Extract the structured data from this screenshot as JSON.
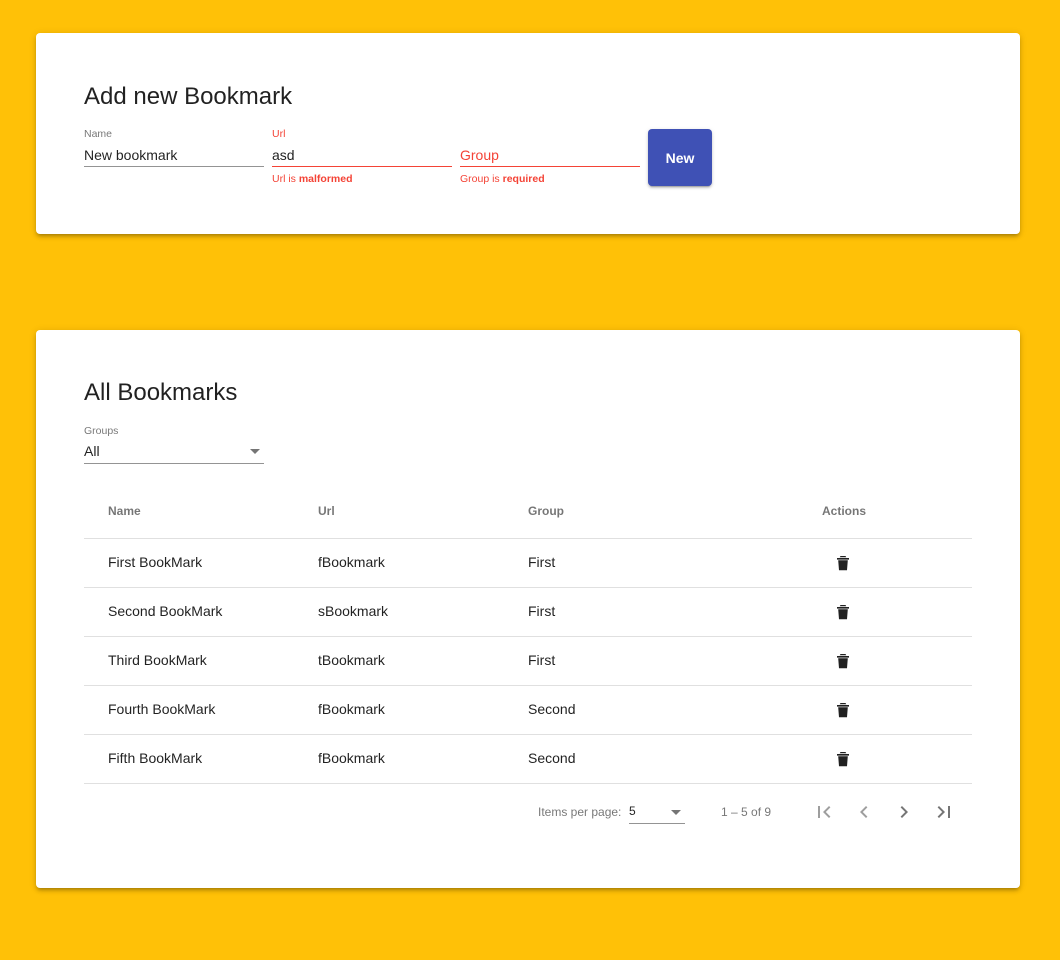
{
  "add_card": {
    "title": "Add new Bookmark",
    "name_field": {
      "label": "Name",
      "value": "New bookmark"
    },
    "url_field": {
      "label": "Url",
      "value": "asd",
      "error_prefix": "Url is ",
      "error_strong": "malformed"
    },
    "group_field": {
      "placeholder": "Group",
      "value": "",
      "error_prefix": "Group is ",
      "error_strong": "required"
    },
    "new_button": "New",
    "colors": {
      "accent": "#3f51b5",
      "error": "#f44336",
      "background": "#ffc107"
    }
  },
  "list_card": {
    "title": "All Bookmarks",
    "groups_select": {
      "label": "Groups",
      "value": "All"
    },
    "table": {
      "headers": {
        "name": "Name",
        "url": "Url",
        "group": "Group",
        "actions": "Actions"
      },
      "rows": [
        {
          "name": "First BookMark",
          "url": "fBookmark",
          "group": "First",
          "action_icon": "delete-icon"
        },
        {
          "name": "Second BookMark",
          "url": "sBookmark",
          "group": "First",
          "action_icon": "delete-icon"
        },
        {
          "name": "Third BookMark",
          "url": "tBookmark",
          "group": "First",
          "action_icon": "delete-icon"
        },
        {
          "name": "Fourth BookMark",
          "url": "fBookmark",
          "group": "Second",
          "action_icon": "delete-icon"
        },
        {
          "name": "Fifth BookMark",
          "url": "fBookmark",
          "group": "Second",
          "action_icon": "delete-icon"
        }
      ]
    },
    "paginator": {
      "items_per_page_label": "Items per page:",
      "items_per_page_value": "5",
      "range_label": "1 – 5 of 9",
      "buttons": [
        "first-page-icon",
        "previous-page-icon",
        "next-page-icon",
        "last-page-icon"
      ]
    }
  }
}
